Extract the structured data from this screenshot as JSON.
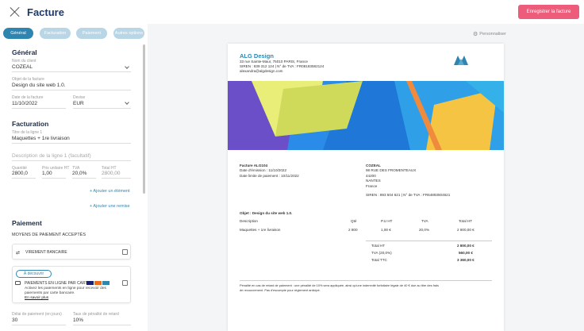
{
  "header": {
    "title": "Facture",
    "save_label": "Enregistrer la facture"
  },
  "tabs": [
    "Général",
    "Facturation",
    "Paiement",
    "Autres options"
  ],
  "general": {
    "section_title": "Général",
    "client_label": "Nom du client",
    "client_value": "COZEAL",
    "object_label": "Objet de la facture",
    "object_value": "Design du site web 1.0.",
    "date_label": "Date de la facture",
    "date_value": "11/10/2022",
    "currency_label": "Devise",
    "currency_value": "EUR"
  },
  "billing": {
    "section_title": "Facturation",
    "line_title_label": "Titre de la ligne 1",
    "line_title_value": "Maquettes + 1re livraison",
    "line_desc_placeholder": "Description de la ligne 1 (facultatif)",
    "qty_label": "Quantité",
    "qty_value": "2800,0",
    "unit_price_label": "Prix unitaire HT",
    "unit_price_value": "1,00",
    "tva_label": "TVA",
    "tva_value": "20,0%",
    "total_label": "Total HT",
    "total_value": "2800,00",
    "add_line_label": "+ Ajouter un élément",
    "add_discount_label": "+ Ajouter une remise"
  },
  "payment": {
    "section_title": "Paiement",
    "methods_title": "MOYENS DE PAIEMENT ACCEPTÉS",
    "transfer_label": "VIREMENT BANCAIRE",
    "discover_label": "À découvrir",
    "online_label": "PAIEMENTS EN LIGNE PAR CARTE",
    "online_desc1": "Activez les paiements en ligne pour recevoir des",
    "online_desc2": "paiements par carte bancaire.",
    "learn_more": "En savoir plus",
    "delay_label": "Délai de paiement (en jours)",
    "delay_value": "30",
    "late_label": "Taux de pénalité de retard",
    "late_value": "10%"
  },
  "preview": {
    "personalise_label": "Personnaliser",
    "company_name": "ALG Design",
    "company_address": "33 rue Sainte-Maur, 75010 PARIS, France",
    "company_ids": "SIREN : 839 312 124  |  N° de TVA : FR08183582124",
    "company_email": "alexandra@algdesign.com",
    "invoice_number": "Facture ALG104",
    "issue_date": "Date d'émission : 11/10/2022",
    "due_date": "Date limite de paiement : 10/11/2022",
    "client_name": "COZEAL",
    "client_street": "98 RUE DES FROMENTEAUX",
    "client_zip": "44200",
    "client_city": "NANTES",
    "client_country": "France",
    "client_ids": "SIREN : 893 504 621  |  N° de TVA : FR64893504621",
    "object": "Objet : Design du site web 1.0.",
    "table_headers": [
      "Description",
      "Qté",
      "P.U HT",
      "TVA",
      "Total HT"
    ],
    "table_row": [
      "Maquettes + 1re livraison",
      "2 800",
      "1,00 €",
      "20,0%",
      "2 800,00 €"
    ],
    "totals": [
      {
        "label": "Total HT",
        "value": "2 800,00 €"
      },
      {
        "label": "TVA (20,0%)",
        "value": "560,00 €"
      },
      {
        "label": "Total TTC",
        "value": "3 360,00 €"
      }
    ],
    "footer_note1": "Pénalité en cas de retard de paiement : une pénalité de 10% sera appliquée, ainsi qu'une indemnité forfaitaire légale de 40 € due au titre des frais",
    "footer_note2": "de recouvrement. Pas d'escompte pour règlement anticipé.",
    "brand_color": "#2e86b0",
    "accent_color": "#ee5c7b"
  }
}
